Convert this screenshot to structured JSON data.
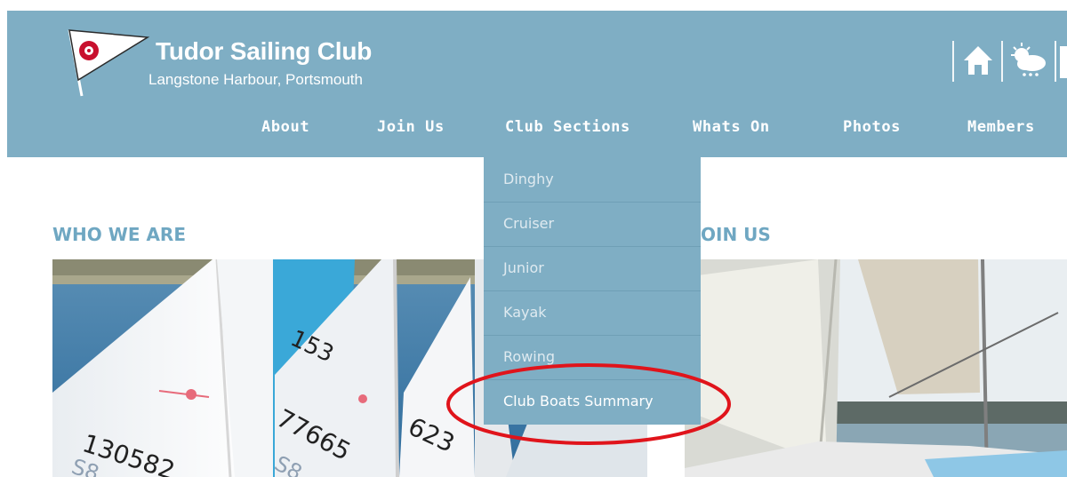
{
  "header": {
    "title": "Tudor Sailing Club",
    "subtitle": "Langstone Harbour, Portsmouth",
    "icons": [
      "flag-logo",
      "home-icon",
      "weather-icon"
    ]
  },
  "nav": {
    "items": [
      {
        "label": "About"
      },
      {
        "label": "Join Us"
      },
      {
        "label": "Club Sections"
      },
      {
        "label": "Whats On"
      },
      {
        "label": "Photos"
      },
      {
        "label": "Members"
      }
    ]
  },
  "dropdown": {
    "items": [
      {
        "label": "Dinghy"
      },
      {
        "label": "Cruiser"
      },
      {
        "label": "Junior"
      },
      {
        "label": "Kayak"
      },
      {
        "label": "Rowing"
      },
      {
        "label": "Club Boats Summary"
      }
    ]
  },
  "sections": {
    "who": {
      "title": "WHO WE ARE"
    },
    "join": {
      "title": "OIN US"
    }
  },
  "photo_text": {
    "sail_1": "130582",
    "sail_1b": "S8",
    "sail_2": "153",
    "sail_3": "77665",
    "sail_3b": "S8",
    "sail_4": "623"
  },
  "colors": {
    "header_bg": "#7faec4",
    "section_title": "#6fa7c2",
    "annotation": "#e0141b"
  }
}
